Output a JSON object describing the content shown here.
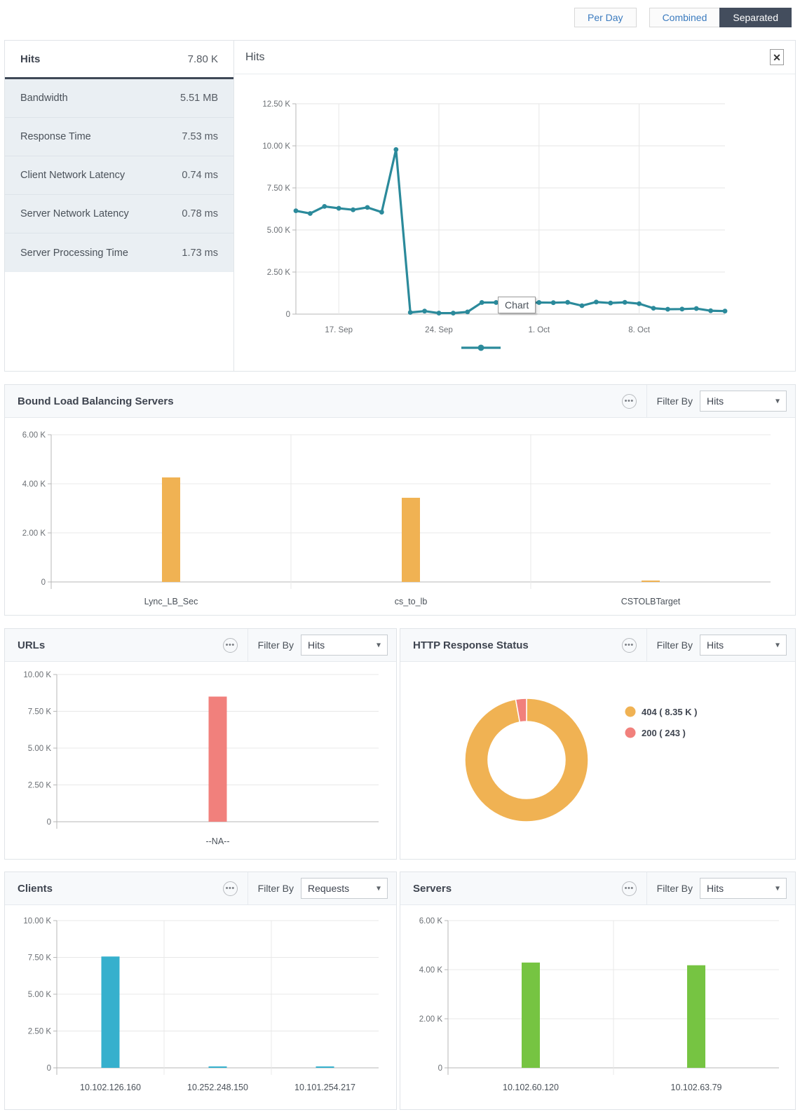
{
  "toolbar": {
    "per_day_label": "Per Day",
    "combined_label": "Combined",
    "separated_label": "Separated",
    "active": "Separated"
  },
  "metrics_panel": {
    "selected": {
      "label": "Hits",
      "value": "7.80 K"
    },
    "items": [
      {
        "label": "Bandwidth",
        "value": "5.51 MB"
      },
      {
        "label": "Response Time",
        "value": "7.53 ms"
      },
      {
        "label": "Client Network Latency",
        "value": "0.74 ms"
      },
      {
        "label": "Server Network Latency",
        "value": "0.78 ms"
      },
      {
        "label": "Server Processing Time",
        "value": "1.73 ms"
      }
    ]
  },
  "hits_chart": {
    "title": "Hits",
    "close_label": "✕",
    "tooltip": "Chart"
  },
  "panels": {
    "bound_lb": {
      "title": "Bound Load Balancing Servers",
      "filter_label": "Filter By",
      "filter_value": "Hits",
      "menu": "•••"
    },
    "urls": {
      "title": "URLs",
      "filter_label": "Filter By",
      "filter_value": "Hits",
      "menu": "•••"
    },
    "http_status": {
      "title": "HTTP Response Status",
      "filter_label": "Filter By",
      "filter_value": "Hits",
      "menu": "•••"
    },
    "clients": {
      "title": "Clients",
      "filter_label": "Filter By",
      "filter_value": "Requests",
      "menu": "•••"
    },
    "servers": {
      "title": "Servers",
      "filter_label": "Filter By",
      "filter_value": "Hits",
      "menu": "•••"
    }
  },
  "chart_data": [
    {
      "id": "hits_timeseries",
      "type": "line",
      "title": "Hits",
      "xlabel": "",
      "ylabel": "",
      "ylim": [
        0,
        12500
      ],
      "yticks": [
        0,
        2500,
        5000,
        7500,
        10000,
        12500
      ],
      "ytick_labels": [
        "0",
        "2.50 K",
        "5.00 K",
        "7.50 K",
        "10.00 K",
        "12.50 K"
      ],
      "xtick_labels": [
        "17. Sep",
        "24. Sep",
        "1. Oct",
        "8. Oct"
      ],
      "xtick_positions": [
        3,
        10,
        17,
        24
      ],
      "grid": true,
      "legend": "marker-only",
      "color": "#2b8a9b",
      "x": [
        0,
        1,
        2,
        3,
        4,
        5,
        6,
        7,
        8,
        9,
        10,
        11,
        12,
        13,
        14,
        15,
        16,
        17,
        18,
        19,
        20,
        21,
        22,
        23,
        24,
        25,
        26,
        27,
        28,
        29,
        30
      ],
      "values": [
        6140,
        5980,
        6400,
        6290,
        6200,
        6340,
        6060,
        9780,
        100,
        180,
        60,
        60,
        130,
        690,
        690,
        680,
        650,
        690,
        680,
        700,
        500,
        720,
        660,
        700,
        620,
        350,
        290,
        300,
        330,
        200,
        180
      ]
    },
    {
      "id": "bound_lb_servers",
      "type": "bar",
      "title": "Bound Load Balancing Servers",
      "categories": [
        "Lync_LB_Sec",
        "cs_to_lb",
        "CSTOLBTarget"
      ],
      "values": [
        4260,
        3430,
        30
      ],
      "ylim": [
        0,
        6000
      ],
      "yticks": [
        0,
        2000,
        4000,
        6000
      ],
      "ytick_labels": [
        "0",
        "2.00 K",
        "4.00 K",
        "6.00 K"
      ],
      "color": "#f0b253",
      "grid": true
    },
    {
      "id": "urls",
      "type": "bar",
      "title": "URLs",
      "categories": [
        "--NA--"
      ],
      "values": [
        8500
      ],
      "ylim": [
        0,
        10000
      ],
      "yticks": [
        0,
        2500,
        5000,
        7500,
        10000
      ],
      "ytick_labels": [
        "0",
        "2.50 K",
        "5.00 K",
        "7.50 K",
        "10.00 K"
      ],
      "color": "#f1807c",
      "grid": true
    },
    {
      "id": "http_response_status",
      "type": "pie",
      "title": "HTTP Response Status",
      "labels": [
        "404 ( 8.35 K )",
        "200 ( 243 )"
      ],
      "values": [
        8350,
        243
      ],
      "colors": [
        "#f0b253",
        "#f1807c"
      ],
      "legend_position": "right",
      "donut": true
    },
    {
      "id": "clients",
      "type": "bar",
      "title": "Clients",
      "categories": [
        "10.102.126.160",
        "10.252.248.150",
        "10.101.254.217"
      ],
      "values": [
        7560,
        90,
        60
      ],
      "ylim": [
        0,
        10000
      ],
      "yticks": [
        0,
        2500,
        5000,
        7500,
        10000
      ],
      "ytick_labels": [
        "0",
        "2.50 K",
        "5.00 K",
        "7.50 K",
        "10.00 K"
      ],
      "color": "#36b0cd",
      "grid": true
    },
    {
      "id": "servers",
      "type": "bar",
      "title": "Servers",
      "categories": [
        "10.102.60.120",
        "10.102.63.79"
      ],
      "values": [
        4290,
        4180
      ],
      "ylim": [
        0,
        6000
      ],
      "yticks": [
        0,
        2000,
        4000,
        6000
      ],
      "ytick_labels": [
        "0",
        "2.00 K",
        "4.00 K",
        "6.00 K"
      ],
      "color": "#76c442",
      "grid": true
    }
  ]
}
